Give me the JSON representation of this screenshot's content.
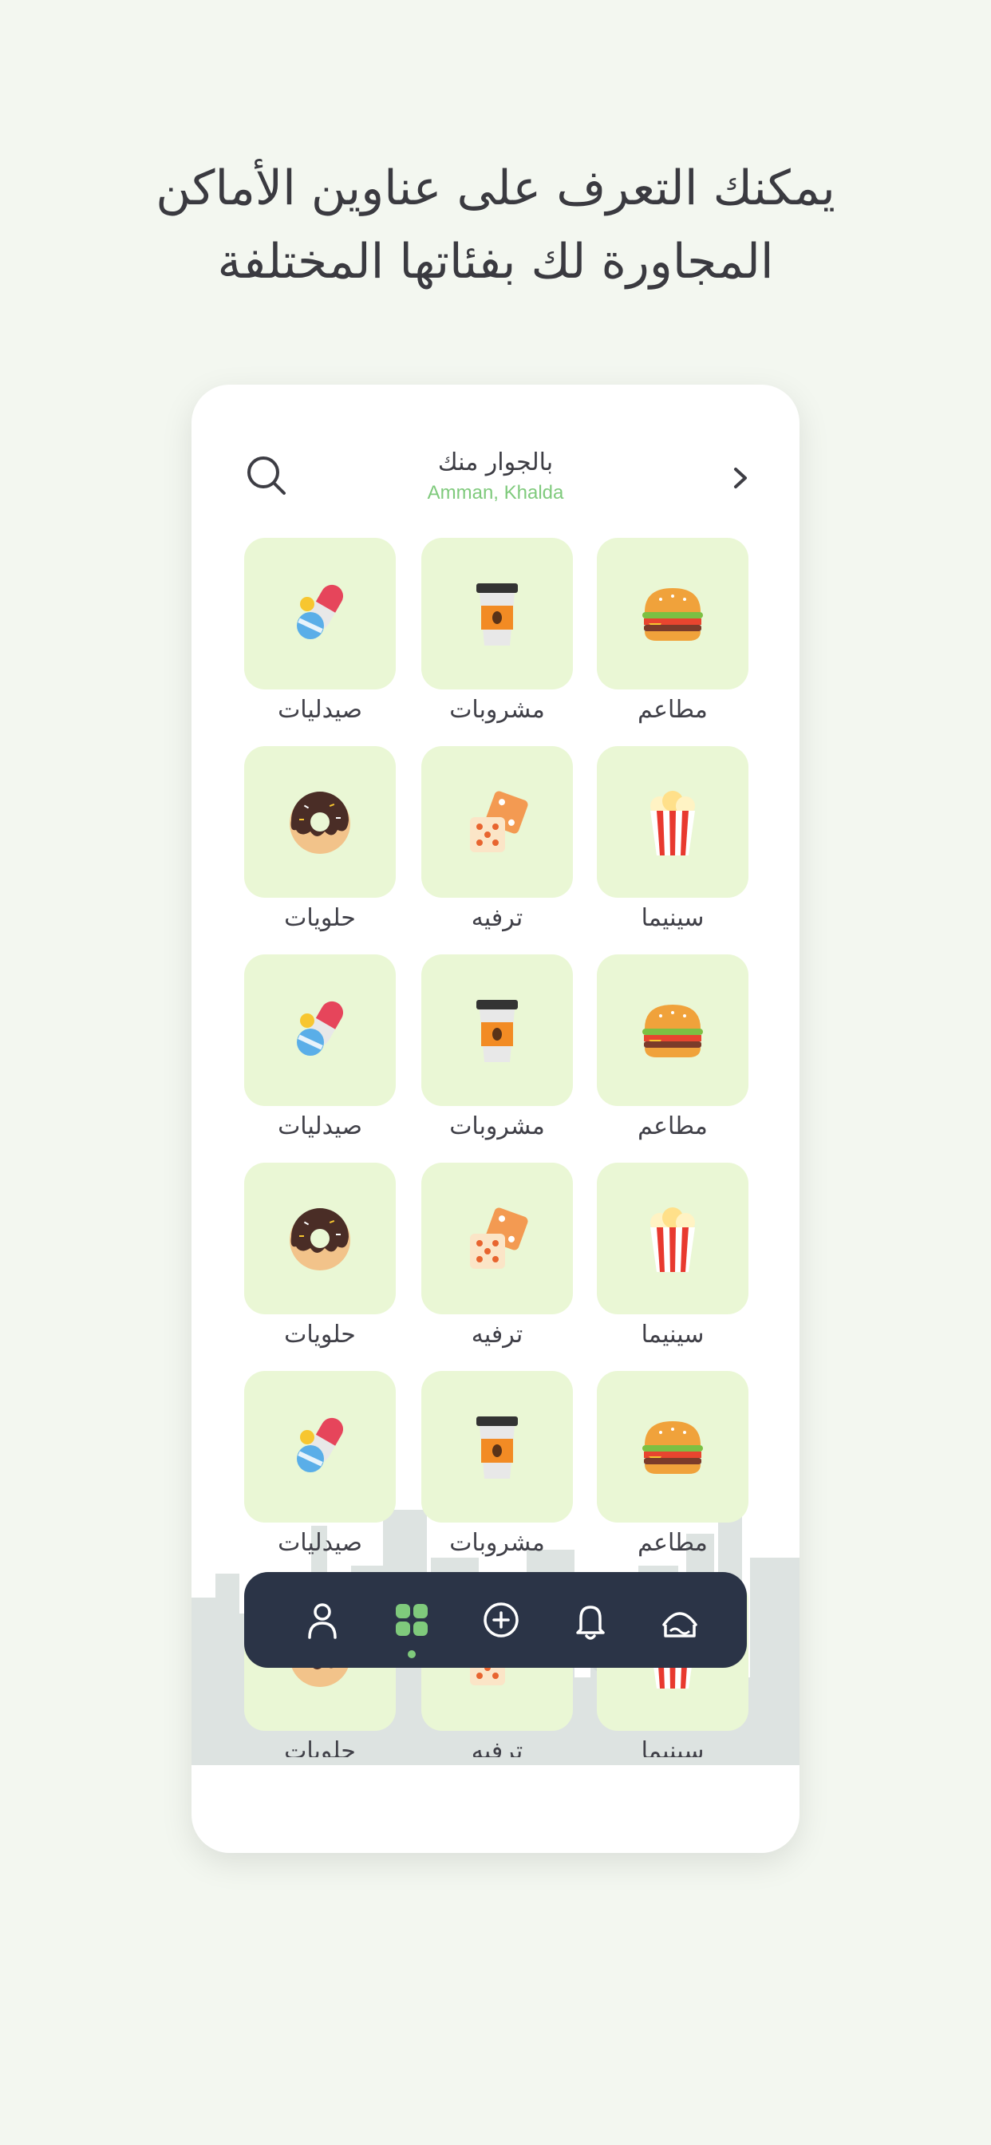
{
  "headline": {
    "line1": "يمكنك التعرف على عناوين الأماكن",
    "line2": "المجاورة لك بفئاتها المختلفة"
  },
  "header": {
    "title": "بالجوار منك",
    "location": "Amman, Khalda"
  },
  "categories": [
    {
      "label": "مطاعم",
      "icon": "burger-icon"
    },
    {
      "label": "مشروبات",
      "icon": "coffee-cup-icon"
    },
    {
      "label": "صيدليات",
      "icon": "pills-icon"
    },
    {
      "label": "سينيما",
      "icon": "popcorn-icon"
    },
    {
      "label": "ترفيه",
      "icon": "dice-icon"
    },
    {
      "label": "حلويات",
      "icon": "donut-icon"
    },
    {
      "label": "مطاعم",
      "icon": "burger-icon"
    },
    {
      "label": "مشروبات",
      "icon": "coffee-cup-icon"
    },
    {
      "label": "صيدليات",
      "icon": "pills-icon"
    },
    {
      "label": "سينيما",
      "icon": "popcorn-icon"
    },
    {
      "label": "ترفيه",
      "icon": "dice-icon"
    },
    {
      "label": "حلويات",
      "icon": "donut-icon"
    },
    {
      "label": "مطاعم",
      "icon": "burger-icon"
    },
    {
      "label": "مشروبات",
      "icon": "coffee-cup-icon"
    },
    {
      "label": "صيدليات",
      "icon": "pills-icon"
    },
    {
      "label": "سينيما",
      "icon": "popcorn-icon"
    },
    {
      "label": "ترفيه",
      "icon": "dice-icon"
    },
    {
      "label": "حلويات",
      "icon": "donut-icon"
    }
  ],
  "nav": [
    {
      "icon": "home-icon",
      "active": false
    },
    {
      "icon": "bell-icon",
      "active": false
    },
    {
      "icon": "add-circle-icon",
      "active": false
    },
    {
      "icon": "grid-icon",
      "active": true
    },
    {
      "icon": "profile-icon",
      "active": false
    }
  ],
  "colors": {
    "background": "#f3f7f0",
    "tile": "#eaf7d5",
    "accent": "#7fca7c",
    "navbar": "#2b3447"
  }
}
